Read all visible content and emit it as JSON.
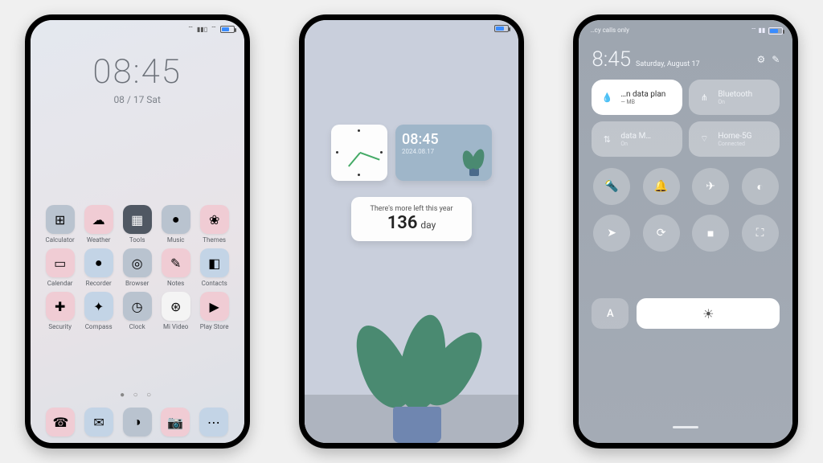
{
  "launcher": {
    "clock": "08:45",
    "date": "08 / 17  Sat",
    "apps": [
      {
        "label": "Calculator",
        "glyph": "⊞",
        "cls": "c-grey"
      },
      {
        "label": "Weather",
        "glyph": "☁",
        "cls": "c-pink"
      },
      {
        "label": "Tools",
        "glyph": "▦",
        "cls": "c-dark"
      },
      {
        "label": "Music",
        "glyph": "●",
        "cls": "c-grey"
      },
      {
        "label": "Themes",
        "glyph": "❀",
        "cls": "c-pink"
      },
      {
        "label": "Calendar",
        "glyph": "▭",
        "cls": "c-pink"
      },
      {
        "label": "Recorder",
        "glyph": "●",
        "cls": "c-blue"
      },
      {
        "label": "Browser",
        "glyph": "◎",
        "cls": "c-grey"
      },
      {
        "label": "Notes",
        "glyph": "✎",
        "cls": "c-pink"
      },
      {
        "label": "Contacts",
        "glyph": "◧",
        "cls": "c-blue"
      },
      {
        "label": "Security",
        "glyph": "✚",
        "cls": "c-pink"
      },
      {
        "label": "Compass",
        "glyph": "✦",
        "cls": "c-blue"
      },
      {
        "label": "Clock",
        "glyph": "◷",
        "cls": "c-grey"
      },
      {
        "label": "Mi Video",
        "glyph": "⊛",
        "cls": "c-white"
      },
      {
        "label": "Play Store",
        "glyph": "▶",
        "cls": "c-pink"
      }
    ],
    "dock": [
      {
        "label": "",
        "glyph": "☎",
        "cls": "c-pink"
      },
      {
        "label": "",
        "glyph": "✉",
        "cls": "c-blue"
      },
      {
        "label": "",
        "glyph": "◑",
        "cls": "c-grey"
      },
      {
        "label": "",
        "glyph": "📷",
        "cls": "c-pink"
      },
      {
        "label": "",
        "glyph": "⋯",
        "cls": "c-blue"
      }
    ]
  },
  "widgets": {
    "digital_time": "08:45",
    "digital_date": "2024.08.17",
    "countdown_label": "There's more left this year",
    "countdown_value": "136",
    "countdown_unit": "day"
  },
  "cc": {
    "carrier": "…cy calls only",
    "time": "8:45",
    "date": "Saturday, August 17",
    "tiles": [
      {
        "icon": "💧",
        "title": "…n data plan",
        "sub": "— MB",
        "active": true
      },
      {
        "icon": "⋔",
        "title": "Bluetooth",
        "sub": "On",
        "active": false
      },
      {
        "icon": "⇅",
        "title": "data    M…",
        "sub": "On",
        "active": false
      },
      {
        "icon": "⌔",
        "title": "Home-5G",
        "sub": "Connected",
        "active": false
      }
    ],
    "toggles": [
      "flashlight",
      "bell",
      "airplane",
      "contrast",
      "location",
      "rotate",
      "video",
      "scan",
      "mic",
      "cast"
    ],
    "toggle_glyphs": [
      "🔦",
      "🔔",
      "✈",
      "◐",
      "➤",
      "⟳",
      "■",
      "⛶",
      "",
      ""
    ],
    "auto_label": "A",
    "brightness_glyph": "☀"
  }
}
